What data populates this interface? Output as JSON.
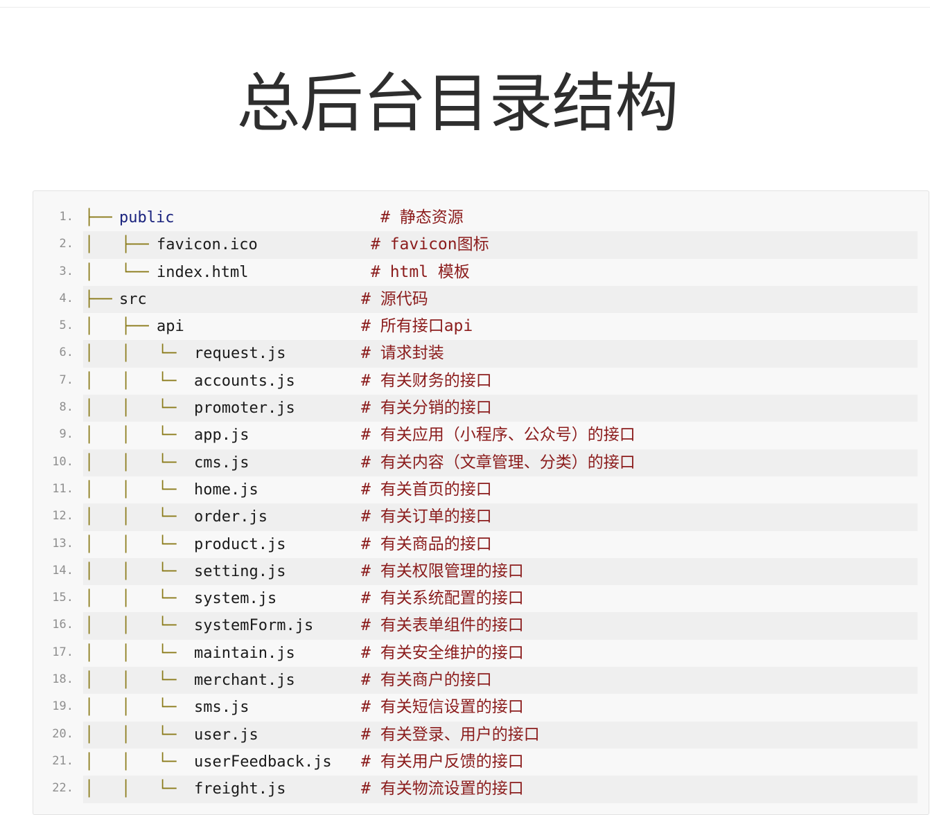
{
  "page": {
    "title": "总后台目录结构"
  },
  "code": {
    "lines": [
      {
        "no": "1.",
        "tree": "├── ",
        "name": "public",
        "comment": "# 静态资源"
      },
      {
        "no": "2.",
        "tree": "│   ├── ",
        "name": "favicon.ico",
        "comment": "# favicon图标"
      },
      {
        "no": "3.",
        "tree": "│   └── ",
        "name": "index.html",
        "comment": "# html 模板"
      },
      {
        "no": "4.",
        "tree": "├── ",
        "name": "src",
        "comment": "# 源代码"
      },
      {
        "no": "5.",
        "tree": "│   ├── ",
        "name": "api",
        "comment": "# 所有接口api"
      },
      {
        "no": "6.",
        "tree": "│   │   └─",
        "name": "request.js",
        "comment": "# 请求封装"
      },
      {
        "no": "7.",
        "tree": "│   │   └─",
        "name": "accounts.js",
        "comment": "# 有关财务的接口"
      },
      {
        "no": "8.",
        "tree": "│   │   └─",
        "name": "promoter.js",
        "comment": "# 有关分销的接口"
      },
      {
        "no": "9.",
        "tree": "│   │   └─",
        "name": "app.js",
        "comment": "# 有关应用（小程序、公众号）的接口"
      },
      {
        "no": "10.",
        "tree": "│   │   └─",
        "name": "cms.js",
        "comment": "# 有关内容（文章管理、分类）的接口"
      },
      {
        "no": "11.",
        "tree": "│   │   └─",
        "name": "home.js",
        "comment": "# 有关首页的接口"
      },
      {
        "no": "12.",
        "tree": "│   │   └─",
        "name": "order.js",
        "comment": "# 有关订单的接口"
      },
      {
        "no": "13.",
        "tree": "│   │   └─",
        "name": "product.js",
        "comment": "# 有关商品的接口"
      },
      {
        "no": "14.",
        "tree": "│   │   └─",
        "name": "setting.js",
        "comment": "# 有关权限管理的接口"
      },
      {
        "no": "15.",
        "tree": "│   │   └─",
        "name": "system.js",
        "comment": "# 有关系统配置的接口"
      },
      {
        "no": "16.",
        "tree": "│   │   └─",
        "name": "systemForm.js",
        "comment": "# 有关表单组件的接口"
      },
      {
        "no": "17.",
        "tree": "│   │   └─",
        "name": "maintain.js",
        "comment": "# 有关安全维护的接口"
      },
      {
        "no": "18.",
        "tree": "│   │   └─",
        "name": "merchant.js",
        "comment": "# 有关商户的接口"
      },
      {
        "no": "19.",
        "tree": "│   │   └─",
        "name": "sms.js",
        "comment": "# 有关短信设置的接口"
      },
      {
        "no": "20.",
        "tree": "│   │   └─",
        "name": "user.js",
        "comment": "# 有关登录、用户的接口"
      },
      {
        "no": "21.",
        "tree": "│   │   └─",
        "name": "userFeedback.js",
        "comment": "# 有关用户反馈的接口"
      },
      {
        "no": "22.",
        "tree": "│   │   └─",
        "name": "freight.js",
        "comment": "# 有关物流设置的接口"
      }
    ]
  }
}
